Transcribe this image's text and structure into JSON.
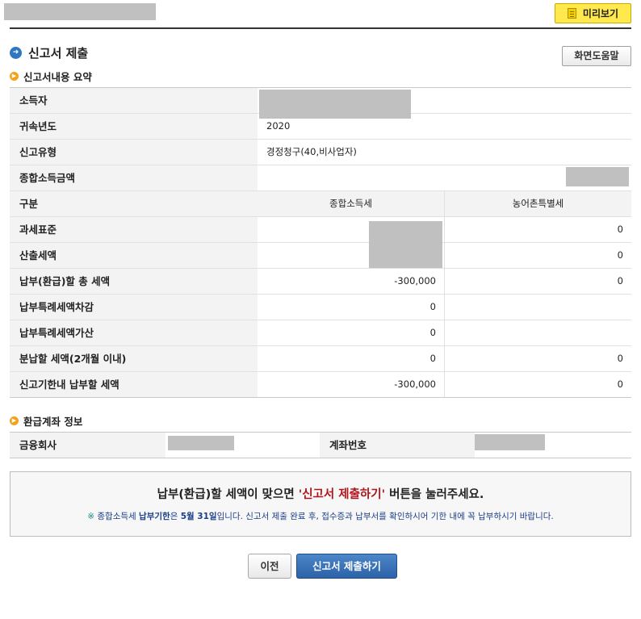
{
  "header": {
    "preview_label": "미리보기",
    "preview_icon": "document-icon"
  },
  "page_title": "신고서 제출",
  "help_label": "화면도움말",
  "summary_section": {
    "title": "신고서내용 요약",
    "rows": {
      "taxpayer": {
        "label": "소득자"
      },
      "year": {
        "label": "귀속년도",
        "value": "2020"
      },
      "type": {
        "label": "신고유형",
        "value": "경정청구(40,비사업자)"
      },
      "income": {
        "label": "종합소득금액"
      },
      "header": {
        "label": "구분",
        "col1": "종합소득세",
        "col2": "농어촌특별세"
      },
      "tax_base": {
        "label": "과세표준",
        "col2": "0"
      },
      "calc_tax": {
        "label": "산출세액",
        "col2": "0"
      },
      "total_due": {
        "label": "납부(환급)할 총 세액",
        "col1": "-300,000",
        "col2": "0"
      },
      "special_deduct": {
        "label": "납부특례세액차감",
        "col1": "0"
      },
      "special_add": {
        "label": "납부특례세액가산",
        "col1": "0"
      },
      "installment": {
        "label": "분납할 세액(2개월 이내)",
        "col1": "0",
        "col2": "0"
      },
      "due_in_time": {
        "label": "신고기한내 납부할 세액",
        "col1": "-300,000",
        "col2": "0"
      }
    }
  },
  "refund_section": {
    "title": "환급계좌 정보",
    "bank_label": "금융회사",
    "account_label": "계좌번호"
  },
  "notice": {
    "main_before": "납부(환급)할 세액이 맞으면 ",
    "main_highlight": "'신고서 제출하기'",
    "main_after": " 버튼을 눌러주세요.",
    "sub_star": "※",
    "sub_1": " 종합소득세 ",
    "sub_bold_1": "납부기한",
    "sub_2": "은 ",
    "sub_bold_2": "5월 31일",
    "sub_3": "입니다. 신고서 제출 완료 후, 접수증과 납부서를 확인하시어 기한 내에 꼭 납부하시기 바랍니다."
  },
  "buttons": {
    "prev": "이전",
    "submit": "신고서 제출하기"
  },
  "colors": {
    "accent_blue": "#2e78c2",
    "submit_blue": "#2c62a8",
    "highlight_red": "#b0151b",
    "preview_yellow": "#ffe94d"
  }
}
